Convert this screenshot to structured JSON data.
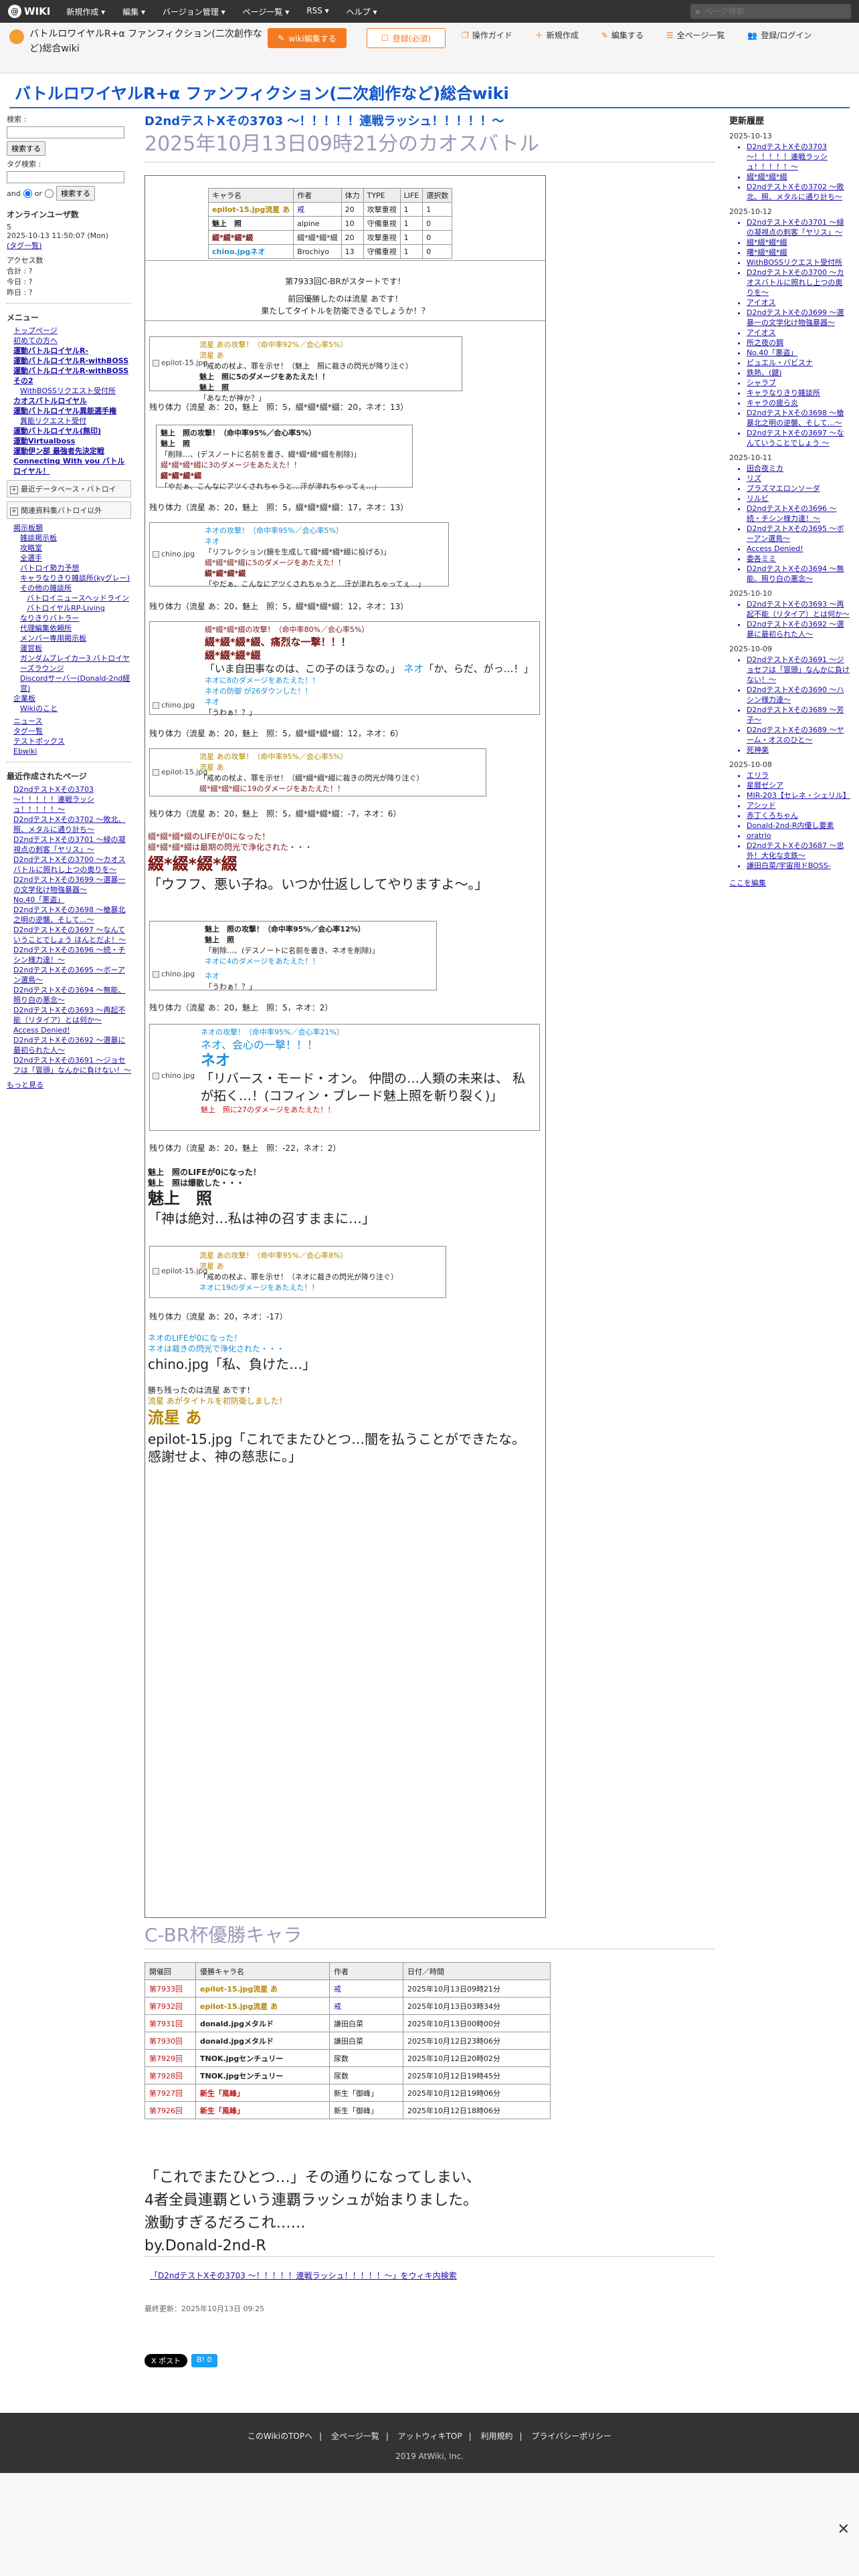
{
  "topbar": {
    "logo": "WIKI",
    "menu": [
      "新規作成 ▾",
      "編集 ▾",
      "バージョン管理 ▾",
      "ページ一覧 ▾",
      "RSS ▾",
      "ヘルプ ▾"
    ],
    "search_placeholder": "ページ検索"
  },
  "header": {
    "site_name": "バトルロワイヤルR+α ファンフィクション(二次創作など)総合wiki",
    "edit_button": "wiki編集する",
    "register_button": "登録(必須)",
    "tools": [
      "操作ガイド",
      "新規作成",
      "編集する",
      "全ページ一覧",
      "登録/ログイン"
    ]
  },
  "wiki_title": "バトルロワイヤルR+α ファンフィクション(二次創作など)総合wiki",
  "left": {
    "search_label": "検索 :",
    "search_button": "検索する",
    "and_label": "and",
    "or_label": "or",
    "tag_label": "タグ検索 :",
    "tag_button": "検索する",
    "online_head": "オンラインユーザ数",
    "online_count": "5",
    "online_date": "2025-10-13 11:50:07 (Mon)",
    "online_tag": "(タグ一覧)",
    "access_head": "アクセス数",
    "access_total": "合計 : ?",
    "access_today": "今日 : ?",
    "access_yesterday": "昨日 : ?",
    "menu_head": "メニュー",
    "menu": [
      {
        "t": "トップページ",
        "lvl": 1,
        "b": false
      },
      {
        "t": "初めての方へ",
        "lvl": 1,
        "b": false
      },
      {
        "t": "運動バトルロイヤルR-",
        "lvl": 1,
        "b": true
      },
      {
        "t": "運動バトルロイヤルR-withBOSS",
        "lvl": 1,
        "b": true
      },
      {
        "t": "運動バトルロイヤルR-withBOSSその2",
        "lvl": 1,
        "b": true
      },
      {
        "t": "WithBOSSリクエスト受付所",
        "lvl": 2,
        "b": false
      },
      {
        "t": "カオスバトルロイヤル",
        "lvl": 1,
        "b": true
      },
      {
        "t": "運動バトルロイヤル異能選手権",
        "lvl": 1,
        "b": true
      },
      {
        "t": "異能リクエスト受付",
        "lvl": 2,
        "b": false
      },
      {
        "t": "運動バトルロイヤル(無印)",
        "lvl": 1,
        "b": true
      },
      {
        "t": "運動Virtualboss",
        "lvl": 1,
        "b": true
      },
      {
        "t": "運動伊ン部 最強者先決定戦",
        "lvl": 1,
        "b": true
      },
      {
        "t": "Connecting With you バトルロイヤル！",
        "lvl": 1,
        "b": true
      }
    ],
    "box1": "最近データベース・バトロイ",
    "box2": "関連資料集バトロイ以外",
    "menu2": [
      {
        "t": "掲示板類",
        "lvl": 1
      },
      {
        "t": "雑談掲示板",
        "lvl": 2
      },
      {
        "t": "攻略室",
        "lvl": 2
      },
      {
        "t": "全選手",
        "lvl": 2
      },
      {
        "t": "バトロイ勢力予想",
        "lvl": 2
      },
      {
        "t": "キャラなりきり雑談所(kyグレー)その他の雑談所",
        "lvl": 2
      },
      {
        "t": "バトロイニュースヘッドライン",
        "lvl": 3
      },
      {
        "t": "バトロイヤルRP-Living",
        "lvl": 3
      },
      {
        "t": "なりきりバトラー",
        "lvl": 2
      },
      {
        "t": "代理編集依頼所",
        "lvl": 2
      },
      {
        "t": "メンバー専用掲示板",
        "lvl": 2
      },
      {
        "t": "運営板",
        "lvl": 2
      },
      {
        "t": "ガンダムブレイカー3 バトロイヤーズラウンジ",
        "lvl": 2
      },
      {
        "t": "Discordサーバー(Donald-2nd経営)",
        "lvl": 2
      },
      {
        "t": "企業板",
        "lvl": 1
      },
      {
        "t": "Wikiのこと",
        "lvl": 2
      }
    ],
    "menu3": [
      "ニュース",
      "タグ一覧",
      "テストボックス",
      "Ebwiki"
    ],
    "recent_head": "最近作成されたページ",
    "recent": [
      "D2ndテストXその3703 〜！！！！！連戦ラッシュ！！！！！〜",
      "D2ndテストXその3702 〜敗北、照、メタルに通り計ち〜",
      "D2ndテストXその3701 〜緑の凝視点の刺客「ヤリス」〜",
      "D2ndテストXその3700 〜カオスバトルに照れし上つの奥りを〜",
      "D2ndテストXその3699 〜選暴一の文学化け物強暴器〜",
      "No.40「悪盗」",
      "D2ndテストXその3698 〜槍暴北之明の逆襲、そして…〜",
      "D2ndテストXその3697 〜なんていうことでしょう ほんとだよ！〜",
      "D2ndテストXその3696 〜続・チシン様力達！〜",
      "D2ndテストXその3695 〜ボーアン選鳥〜",
      "D2ndテストXその3694 〜無能、照り白の悪念〜",
      "D2ndテストXその3693 〜再起不能（リタイア）とは何か〜",
      "Access Denied!",
      "D2ndテストXその3692 〜選暴に最初られた人〜",
      "D2ndテストXその3691 〜ジョセフは「冒頭」なんかに負けない！〜"
    ],
    "more": "もっと見る"
  },
  "main": {
    "page_title": "D2ndテストXその3703 〜！！！！！連戦ラッシュ！！！！！〜",
    "subtitle": "2025年10月13日09時21分のカオスバトル",
    "cast_headers": [
      "キャラ名",
      "作者",
      "体力",
      "TYPE",
      "LIFE",
      "選択数"
    ],
    "cast_rows": [
      [
        "epilot-15.jpg流星 あ",
        "戒",
        "20",
        "攻撃重視",
        "1",
        "1"
      ],
      [
        "魅上　照",
        "alpine",
        "10",
        "守備重視",
        "1",
        "0"
      ],
      [
        "綴*綴*綴*綴",
        "綴*綴*綴*綴",
        "20",
        "攻撃重視",
        "1",
        "0"
      ],
      [
        "chino.jpgネオ",
        "Brochiyo",
        "13",
        "守備重視",
        "1",
        "0"
      ]
    ],
    "start_line": "第7933回C-BRがスタートです！",
    "prev_line": "前回優勝したのは流星 あです！",
    "question_line": "果たしてタイトルを防衛できるでしょうか！？",
    "hp_label": "残り体力",
    "blocks": [
      {
        "img": "epilot-15.jpg",
        "lines": [
          "流星 あの攻撃！（命中率92%／会心率5%）",
          "流星 あ",
          "「戒めの杖よ、罪を示せ！（魅上　照に裁きの閃光が降り注ぐ）",
          "魅上　照に5のダメージをあたえた！！",
          "魅上　照",
          "「あなたが神か？」"
        ]
      },
      {
        "hp": "（流星 あ：20，魅上　照：5，綴*綴*綴*綴：20，ネオ：13）"
      },
      {
        "img": "",
        "lines": [
          "魅上　照の攻撃！（命中率95%／会心率5%）",
          "魅上　照",
          "「削除…、(デスノートに名前を書き、綴*綴*綴*綴を削除)」",
          "綴*綴*綴*綴に3のダメージをあたえた！！",
          "綴*綴*綴*綴",
          "「やだぁ、こんなにアツくされちゃうと…汗が滲れちゃってぇ…」"
        ]
      },
      {
        "hp": "（流星 あ：20，魅上　照：5，綴*綴*綴*綴：17，ネオ：13）"
      },
      {
        "img": "chino.jpg",
        "lines": [
          "ネオの攻撃！（命中率95%／会心率5%）",
          "ネオ",
          "「リフレクション(鏡を生成して綴*綴*綴*綴に投げる)」",
          "綴*綴*綴*綴に5のダメージをあたえた！！",
          "綴*綴*綴*綴",
          "「やだぁ、こんなにアツくされちゃうと…汗が滲れちゃってぇ…」"
        ]
      },
      {
        "hp": "（流星 あ：20，魅上　照：5，綴*綴*綴*綴：12，ネオ：13）"
      }
    ],
    "block4_lines": [
      "綴*綴*綴*綴の攻撃！（命中率80%／会心率5%）",
      "綴*綴*綴*綴、痛烈な一撃！！！",
      "綴*綴*綴*綴",
      "「いま自田事なのは、この子のほうなの。」",
      "ネオ",
      "「か、らだ、がっ…！」",
      "ネオに8のダメージをあたえた！！",
      "ネオの防御 が26ダウンした！！",
      "ネオ",
      "「うわぁ！？」"
    ],
    "hp4": "（流星 あ：20，魅上　照：5，綴*綴*綴*綴：12，ネオ：6）",
    "block5_lines": [
      "流星 あの攻撃！（命中率95%／会心率5%）",
      "流星 あ",
      "「戒めの杖よ、罪を示せ！（綴*綴*綴*綴に裁きの閃光が降り注ぐ）",
      "綴*綴*綴*綴に19のダメージをあたえた！！"
    ],
    "hp5": "（流星 あ：20，魅上　照：5，綴*綴*綴*綴：-7，ネオ：6）",
    "ko1_lines": [
      "綴*綴*綴*綴のLIFEが0になった！",
      "綴*綴*綴*綴は最期の閃光で浄化された・・・"
    ],
    "ko1_big_name": "綴*綴*綴*綴",
    "ko1_big_quote": "「ウフフ、悪い子ね。いつか仕返ししてやりますよ〜。」",
    "block6_lines": [
      "魅上　照の攻撃！（命中率95%／会心率12%）",
      "魅上　照",
      "「削除…、(デスノートに名前を書き、ネオを削除)」",
      "ネオに4のダメージをあたえた！！",
      "ネオ",
      "「うわぁ！？」"
    ],
    "hp6": "（流星 あ：20，魅上　照：5，ネオ：2）",
    "block7_lines": [
      "ネオの攻撃！（命中率95%／会心率21%）",
      "ネオ、会心の一撃！！！",
      "ネオ",
      "「リバース・モード・オン。 仲間の…人類の未来は、 私が拓く…！(コフィン・ブレード魅上照を斬り裂く)」",
      "魅上　照に27のダメージをあたえた！！"
    ],
    "hp7": "（流星 あ：20，魅上　照：-22，ネオ：2）",
    "ko2_lines": [
      "魅上　照のLIFEが0になった！",
      "魅上　照は爆散した・・・"
    ],
    "ko2_big_name": "魅上　照",
    "ko2_big_quote": "「神は絶対…私は神の召すままに…」",
    "block8_lines": [
      "流星 あの攻撃！（命中率95%／会心率8%）",
      "流星 あ",
      "「戒めの杖よ、罪を示せ！（ネオに裁きの閃光が降り注ぐ）",
      "ネオに19のダメージをあたえた！！"
    ],
    "hp8": "（流星 あ：20，ネオ：-17）",
    "ko3_lines": [
      "ネオのLIFEが0になった！",
      "ネオは裁きの閃光で浄化された・・・"
    ],
    "ko3_quote": "chino.jpg「私、負けた…」",
    "win_lines": [
      "勝ち残ったのは流星 あです！",
      "流星 あがタイトルを初防衛しました！"
    ],
    "win_name": "流星 あ",
    "win_quote": "epilot-15.jpg「これでまたひとつ…闇を払うことができたな。感謝せよ、神の慈悲に。」",
    "cbr_title": "C-BR杯優勝キャラ",
    "win_headers": [
      "開催回",
      "優勝キャラ名",
      "作者",
      "日付／時間"
    ],
    "win_rows": [
      [
        "第7933回",
        "epilot-15.jpg流星 あ",
        "戒",
        "2025年10月13日09時21分"
      ],
      [
        "第7932回",
        "epilot-15.jpg流星 あ",
        "戒",
        "2025年10月13日03時34分"
      ],
      [
        "第7931回",
        "donald.jpgメタルド",
        "謙田白菜",
        "2025年10月13日00時00分"
      ],
      [
        "第7930回",
        "donald.jpgメタルド",
        "謙田白菜",
        "2025年10月12日23時06分"
      ],
      [
        "第7929回",
        "TNOK.jpgセンチュリー",
        "尿数",
        "2025年10月12日20時02分"
      ],
      [
        "第7928回",
        "TNOK.jpgセンチュリー",
        "尿数",
        "2025年10月12日19時45分"
      ],
      [
        "第7927回",
        "新生「風峰」",
        "新生「御峰」",
        "2025年10月12日19時06分"
      ],
      [
        "第7926回",
        "新生「風峰」",
        "新生「御峰」",
        "2025年10月12日18時06分"
      ]
    ],
    "closing": [
      "「これでまたひとつ…」その通りになってしまい、",
      "4者全員連覇という連覇ラッシュが始まりました。",
      "激動すぎるだろこれ……",
      "by.Donald-2nd-R"
    ],
    "edit_link": "「D2ndテストXその3703 〜！！！！！連戦ラッシュ！！！！！〜」をウィキ内検索",
    "updated": "最終更新：2025年10月13日 09:25",
    "share_x": "X ポスト",
    "share_b": "B! 0"
  },
  "right": {
    "head": "更新履歴",
    "groups": [
      {
        "date": "2025-10-13",
        "items": [
          "D2ndテストXその3703 〜！！！！！連戦ラッシュ！！！！！〜",
          "綴*綴*綴*綴",
          "D2ndテストXその3702 〜敗北、照、メタルに通り計ち〜"
        ]
      },
      {
        "date": "2025-10-12",
        "items": [
          "D2ndテストXその3701 〜緑の凝視点の刺客「ヤリス」〜",
          "綴*綴*綴*綴",
          "曙*綴*綴*綴",
          "WithBOSSリクエスト受付所",
          "D2ndテストXその3700 〜カオスバトルに照れし上つの奥りを〜",
          "アイオス",
          "D2ndテストXその3699 〜選暴一の文学化け物強暴器〜",
          "アイオス",
          "所之夜の鋼",
          "No.40「悪盗」",
          "ピュエル・バビスナ",
          "鉄熱、(鍵)",
          "シャラブ",
          "キャラなりきり雑談所",
          "キャラの疲ら炎",
          "D2ndテストXその3698 〜槍暴北之明の逆襲、そして…〜",
          "D2ndテストXその3697 〜なんていうことでしょう 〜"
        ]
      },
      {
        "date": "2025-10-11",
        "items": [
          "田合夜ミカ",
          "リズ",
          "プラズマエロンソーダ",
          "リルビ",
          "D2ndテストXその3696 〜続・チシン様力達！〜",
          "D2ndテストXその3695 〜ボーアン選鳥〜",
          "Access Denied!",
          "委各ミミ",
          "D2ndテストXその3694 〜無能、照り白の悪念〜"
        ]
      },
      {
        "date": "2025-10-10",
        "items": [
          "D2ndテストXその3693 〜再起不能（リタイア）とは何か〜",
          "D2ndテストXその3692 〜選暴に最初られた人〜"
        ]
      },
      {
        "date": "2025-10-09",
        "items": [
          "D2ndテストXその3691 〜ジョセフは「冒頭」なんかに負けない！〜",
          "D2ndテストXその3690 〜ハシン様力達〜",
          "D2ndテストXその3689 〜芳子〜",
          "D2ndテストXその3689 〜ヤーム・オスのひと〜",
          "死神楽"
        ]
      },
      {
        "date": "2025-10-08",
        "items": [
          "エリラ",
          "星暦ゼシア",
          "MIR-203【セレネ・シェリル】",
          "アシッド",
          "赤丁くろちゃん",
          "Donald-2nd-R内優し要素",
          "oratrio",
          "D2ndテストXその3687 〜忠外！大化な支鉄〜",
          "謙田白菜/宇宙用ドBOSS-"
        ]
      }
    ],
    "edit_link": "ここを編集"
  },
  "footer": {
    "links": [
      "このWikiのTOPへ",
      "全ページ一覧",
      "アットウィキTOP",
      "利用規約",
      "プライバシーポリシー"
    ],
    "copyright": "2019 AtWiki, Inc."
  }
}
